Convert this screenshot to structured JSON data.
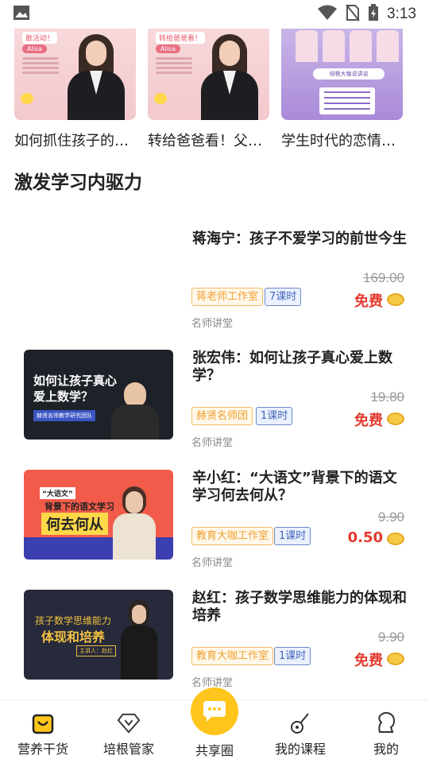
{
  "status_bar": {
    "time": "3:13"
  },
  "top_courses": [
    {
      "title": "如何抓住孩子的…",
      "tag": "敢活动！",
      "name": "Alisa"
    },
    {
      "title": "转给爸爸看！父…",
      "tag": "转给爸爸看！",
      "name": "Alisa"
    },
    {
      "title": "学生时代的恋情…",
      "banner": "培根大咖说讲谈"
    }
  ],
  "section": {
    "title": "激发学习内驱力"
  },
  "courses": [
    {
      "title": "蒋海宁：孩子不爱学习的前世今生",
      "studio": "蒋老师工作室",
      "lessons": "7课时",
      "source": "名师讲堂",
      "price_old": "169.00",
      "price_now": "免费"
    },
    {
      "title": "张宏伟：如何让孩子真心爱上数学？",
      "studio": "赫贤名师团",
      "lessons": "1课时",
      "source": "名师讲堂",
      "price_old": "19.80",
      "price_now": "免费",
      "thumb_text_1": "如何让孩子真心",
      "thumb_text_2": "爱上数学？",
      "thumb_text_3": "赫贤名师教学研究团队"
    },
    {
      "title": "辛小红：“大语文”背景下的语文学习何去何从？",
      "studio": "教育大咖工作室",
      "lessons": "1课时",
      "source": "名师讲堂",
      "price_old": "9.90",
      "price_now": "0.50",
      "thumb_text_1": "“大语文”",
      "thumb_text_2": "背景下的语文学习",
      "thumb_text_3": "何去何从"
    },
    {
      "title": "赵红：孩子数学思维能力的体现和培养",
      "studio": "教育大咖工作室",
      "lessons": "1课时",
      "source": "名师讲堂",
      "price_old": "9.90",
      "price_now": "免费",
      "thumb_text_1": "孩子数学思维能力",
      "thumb_text_2": "体现和培养",
      "thumb_text_3": "主讲人：赵红"
    }
  ],
  "bottom_nav": [
    {
      "label": "营养干货",
      "icon": "home-bag-icon",
      "active": true
    },
    {
      "label": "培根管家",
      "icon": "diamond-heart-icon"
    },
    {
      "label": "共享圈",
      "icon": "chat-bubble-icon"
    },
    {
      "label": "我的课程",
      "icon": "guitar-icon"
    },
    {
      "label": "我的",
      "icon": "profile-icon"
    }
  ],
  "colors": {
    "accent": "#ffc51c",
    "price": "#e53a2e",
    "studio_tag": "#f0a030",
    "lessons_tag": "#4466bb"
  }
}
